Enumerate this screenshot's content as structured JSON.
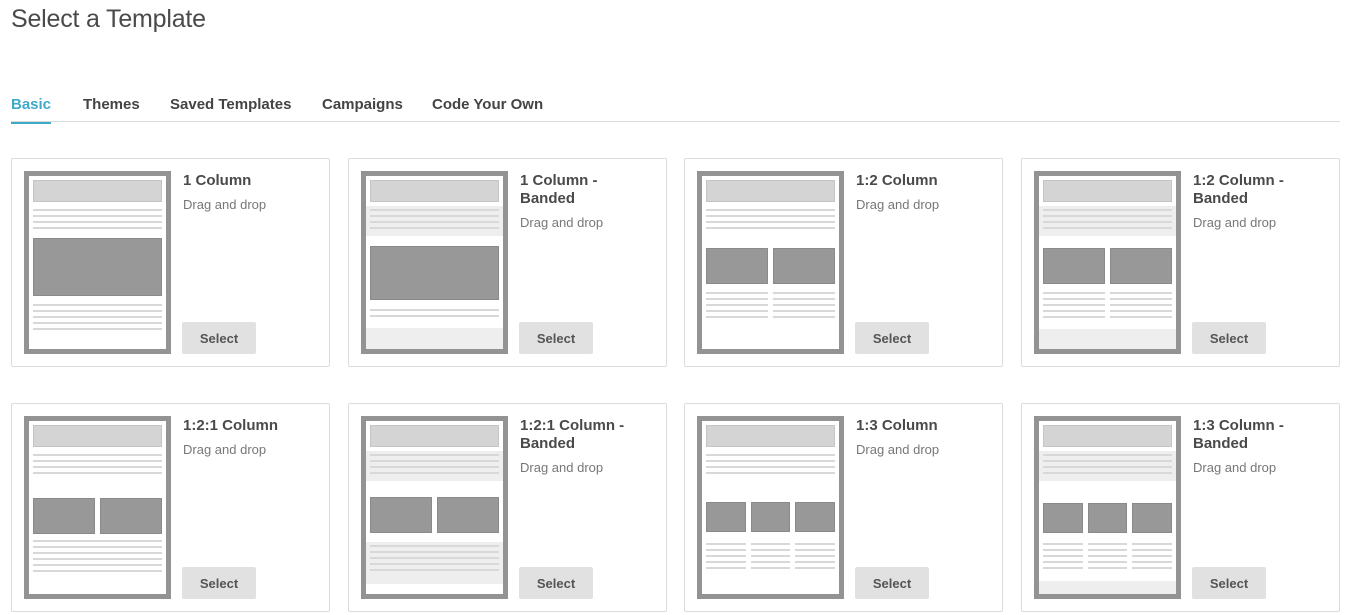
{
  "page": {
    "title": "Select a Template"
  },
  "tabs": [
    {
      "label": "Basic",
      "active": true
    },
    {
      "label": "Themes",
      "active": false
    },
    {
      "label": "Saved Templates",
      "active": false
    },
    {
      "label": "Campaigns",
      "active": false
    },
    {
      "label": "Code Your Own",
      "active": false
    }
  ],
  "templates": [
    {
      "name": "1 Column",
      "subtitle": "Drag and drop",
      "button": "Select",
      "layout": "1col"
    },
    {
      "name": "1 Column - Banded",
      "subtitle": "Drag and drop",
      "button": "Select",
      "layout": "1col-banded"
    },
    {
      "name": "1:2 Column",
      "subtitle": "Drag and drop",
      "button": "Select",
      "layout": "1-2col"
    },
    {
      "name": "1:2 Column - Banded",
      "subtitle": "Drag and drop",
      "button": "Select",
      "layout": "1-2col-banded"
    },
    {
      "name": "1:2:1 Column",
      "subtitle": "Drag and drop",
      "button": "Select",
      "layout": "1-2-1col"
    },
    {
      "name": "1:2:1 Column - Banded",
      "subtitle": "Drag and drop",
      "button": "Select",
      "layout": "1-2-1col-banded"
    },
    {
      "name": "1:3 Column",
      "subtitle": "Drag and drop",
      "button": "Select",
      "layout": "1-3col"
    },
    {
      "name": "1:3 Column - Banded",
      "subtitle": "Drag and drop",
      "button": "Select",
      "layout": "1-3col-banded"
    }
  ],
  "colors": {
    "accent": "#3fa9c9",
    "thumb_frame": "#939393",
    "button_bg": "#e1e1e1"
  }
}
